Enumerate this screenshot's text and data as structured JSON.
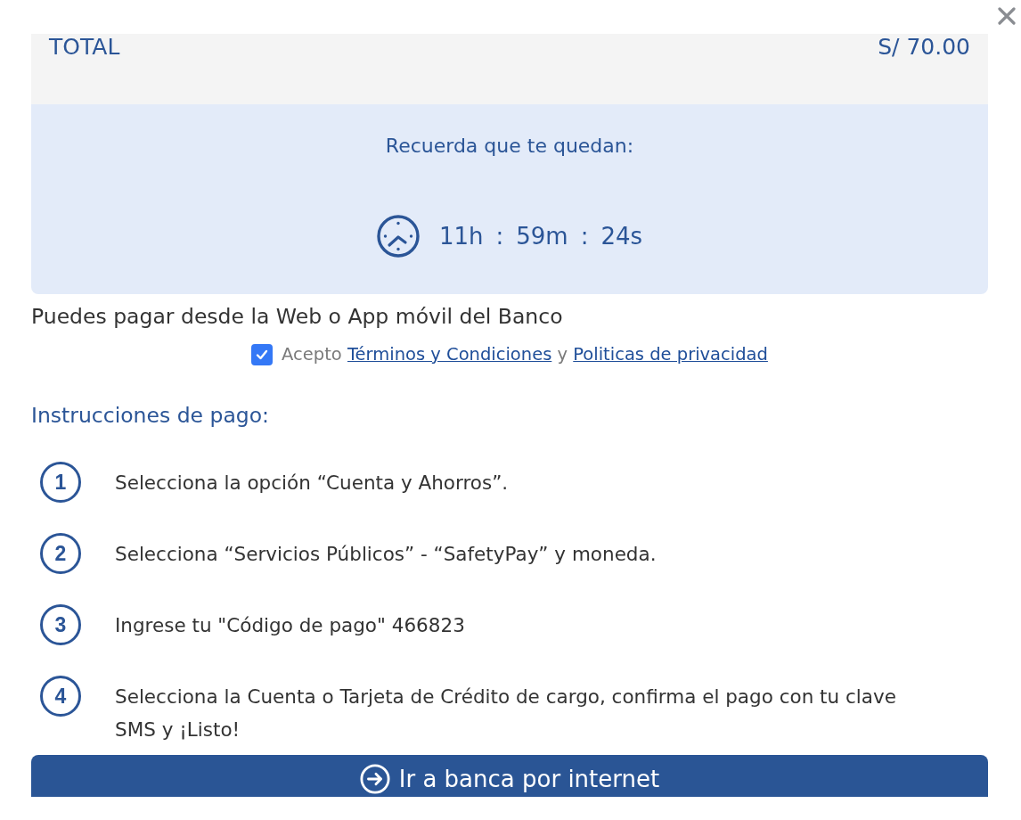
{
  "summary": {
    "label": "TOTAL",
    "amount": "S/ 70.00"
  },
  "countdown": {
    "caption": "Recuerda que te quedan:",
    "parts": [
      {
        "kind": "value",
        "text": "11h"
      },
      {
        "kind": "separator",
        "text": ":"
      },
      {
        "kind": "value",
        "text": "59m"
      },
      {
        "kind": "separator",
        "text": ":"
      },
      {
        "kind": "value",
        "text": "24s"
      }
    ]
  },
  "note": "Puedes pagar desde la Web o App móvil del Banco",
  "consent": {
    "checked": true,
    "parts": [
      {
        "kind": "text",
        "text": "Acepto"
      },
      {
        "kind": "link",
        "text": "Términos y Condiciones"
      },
      {
        "kind": "text",
        "text": "y"
      },
      {
        "kind": "link",
        "text": "Politicas de privacidad"
      }
    ]
  },
  "instructions": {
    "title": "Instrucciones de pago:",
    "steps": [
      {
        "number": "1",
        "text": "Selecciona la opción “Cuenta y Ahorros”."
      },
      {
        "number": "2",
        "text": "Selecciona “Servicios Públicos” - “SafetyPay” y moneda."
      },
      {
        "number": "3",
        "text": "Ingrese tu \"Código de pago\" 466823"
      },
      {
        "number": "4",
        "text": "Selecciona la Cuenta o Tarjeta de Crédito de cargo, confirma el pago con tu clave SMS y ¡Listo!"
      }
    ]
  },
  "action_button": {
    "label": "Ir a banca por internet"
  }
}
